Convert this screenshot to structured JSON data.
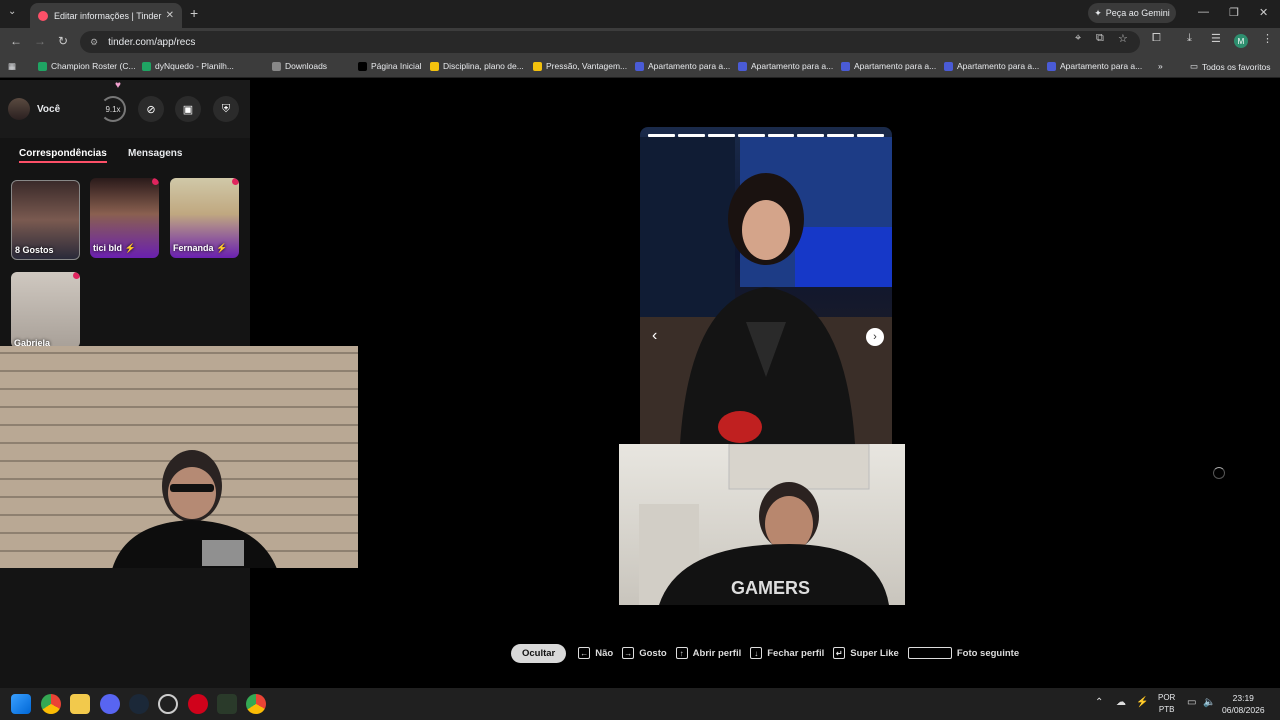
{
  "browser": {
    "tab_title": "Editar informações | Tinder",
    "new_tab": "+",
    "gemini_button": "Peça ao Gemini",
    "url": "tinder.com/app/recs",
    "bookmarks": [
      {
        "label": "Champion Roster (C...",
        "color": "#1fa463"
      },
      {
        "label": "dyNquedo - Planilh...",
        "color": "#1fa463"
      },
      {
        "label": "Downloads",
        "color": "#888888"
      },
      {
        "label": "Página Inicial",
        "color": "#000000"
      },
      {
        "label": "Disciplina, plano de...",
        "color": "#f4c20d"
      },
      {
        "label": "Pressão, Vantagem...",
        "color": "#f4c20d"
      },
      {
        "label": "Apartamento para a...",
        "color": "#4a5bd6"
      },
      {
        "label": "Apartamento para a...",
        "color": "#4a5bd6"
      },
      {
        "label": "Apartamento para a...",
        "color": "#4a5bd6"
      },
      {
        "label": "Apartamento para a...",
        "color": "#4a5bd6"
      },
      {
        "label": "Apartamento para a...",
        "color": "#4a5bd6"
      }
    ],
    "all_bookmarks": "Todos os favoritos",
    "profile_initial": "M"
  },
  "sidebar": {
    "user_label": "Você",
    "boost_count": "9.1x",
    "tabs": {
      "matches": "Correspondências",
      "messages": "Mensagens"
    },
    "cards": [
      {
        "name": "8 Gostos",
        "dot": false
      },
      {
        "name": "tici bld ⚡",
        "dot": true
      },
      {
        "name": "Fernanda ⚡",
        "dot": true
      },
      {
        "name": "Gabriela",
        "dot": true
      }
    ]
  },
  "hints": {
    "hide": "Ocultar",
    "items": [
      {
        "key": "←",
        "label": "Não"
      },
      {
        "key": "→",
        "label": "Gosto"
      },
      {
        "key": "↑",
        "label": "Abrir perfil"
      },
      {
        "key": "↓",
        "label": "Fechar perfil"
      },
      {
        "key": "↵",
        "label": "Super Like"
      },
      {
        "key": "",
        "label": "Foto seguinte"
      }
    ]
  },
  "photo": {
    "total_photos": 8
  },
  "taskbar": {
    "lang_top": "POR",
    "lang_bottom": "PTB",
    "time": "23:19",
    "date": "06/08/2026"
  },
  "colors": {
    "accent": "#fd5068",
    "notification": "#e0245e"
  }
}
